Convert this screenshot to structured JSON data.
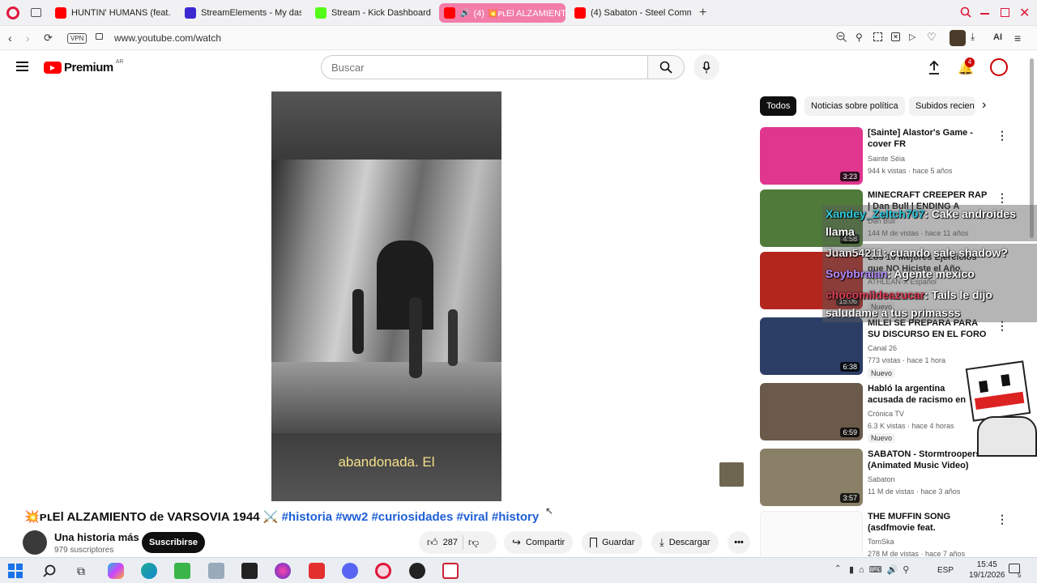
{
  "browser": {
    "tabs": [
      {
        "label": "HUNTIN' HUMANS (feat. J",
        "color": "#ff0000"
      },
      {
        "label": "StreamElements - My dash",
        "color": "#3b2ad1"
      },
      {
        "label": "Stream - Kick Dashboard",
        "color": "#53fc18"
      },
      {
        "label": "(4) 💥ᴘʟEl ALZAMIENT",
        "color": "#ff0000"
      },
      {
        "label": "(4) Sabaton - Steel Comm",
        "color": "#ff0000"
      }
    ],
    "vpn_label": "VPN",
    "url": "www.youtube.com/watch",
    "ai_label": "AI"
  },
  "youtube": {
    "logo_text": "Premium",
    "region": "AR",
    "search_placeholder": "Buscar",
    "notification_count": "4"
  },
  "video": {
    "subtitle": "abandonada. El",
    "title_main": "💥ᴘʟEl ALZAMIENTO de VARSOVIA 1944 ⚔️",
    "title_tags": "#historia #ww2 #curiosidades #viral #history",
    "channel": "Una historia más",
    "subscribers": "979 suscriptores",
    "subscribe_label": "Suscribirse",
    "likes": "287",
    "share_label": "Compartir",
    "save_label": "Guardar",
    "download_label": "Descargar"
  },
  "chips": [
    "Todos",
    "Noticias sobre política",
    "Subidos recien"
  ],
  "recommendations": [
    {
      "title": "[Sainte] Alastor's Game - cover FR",
      "channel": "Sainte Séia",
      "meta": "944 k vistas · hace 5 años",
      "duration": "3:23",
      "thumb": "#e0368e",
      "nuevo": ""
    },
    {
      "title": "MINECRAFT CREEPER RAP | Dan Bull | ENDING A",
      "channel": "Dan Bull",
      "meta": "144 M de vistas · hace 11 años",
      "duration": "4:58",
      "thumb": "#4f7a3a",
      "nuevo": ""
    },
    {
      "title": "Los 10 Mejores Ejercicios que NO Hiciste el Año Anterior",
      "channel": "ATHLEAN-X Español",
      "meta": "",
      "duration": "15:06",
      "thumb": "#b3261e",
      "nuevo": "Nuevo"
    },
    {
      "title": "MILEI SE PREPARA PARA SU DISCURSO EN EL FORO DE ...",
      "channel": "Canal 26",
      "meta": "773 vistas · hace 1 hora",
      "duration": "6:38",
      "thumb": "#2c3e66",
      "nuevo": "Nuevo"
    },
    {
      "title": "Habló la argentina acusada de racismo en Brasil: \"Recibo",
      "channel": "Crónica TV",
      "meta": "6.3 K vistas · hace 4 horas",
      "duration": "6:59",
      "thumb": "#6b5a4a",
      "nuevo": "Nuevo"
    },
    {
      "title": "SABATON - Stormtroopers (Animated Music Video)",
      "channel": "Sabaton",
      "meta": "11 M de vistas · hace 3 años",
      "duration": "3:57",
      "thumb": "#8a8068",
      "nuevo": ""
    },
    {
      "title": "THE MUFFIN SONG (asdfmovie feat. Schmoyoho)",
      "channel": "TomSka",
      "meta": "278 M de vistas · hace 7 años",
      "duration": "",
      "thumb": "#f2f2f2",
      "nuevo": ""
    }
  ],
  "chat": [
    {
      "user": "Xandey_Zeltch707",
      "text": ": Cake androides",
      "color": "#2ecbe0"
    },
    {
      "user": "",
      "text": "llama",
      "color": "#ffffff"
    },
    {
      "user": "Juan54211",
      "text": ": cuando sale shadow?",
      "color": "#e9e9e9"
    },
    {
      "user": "Soybbraian",
      "text": ": Agente mexico",
      "color": "#b48cff"
    },
    {
      "user": "chocomildeazucar",
      "text": ": Tails le dijo",
      "color": "#e0405a"
    },
    {
      "user": "",
      "text": "saludame a tus primasss",
      "color": "#ffffff"
    }
  ],
  "taskbar": {
    "language": "ESP",
    "time": "15:45",
    "date": "19/1/2026",
    "notif": "5"
  }
}
